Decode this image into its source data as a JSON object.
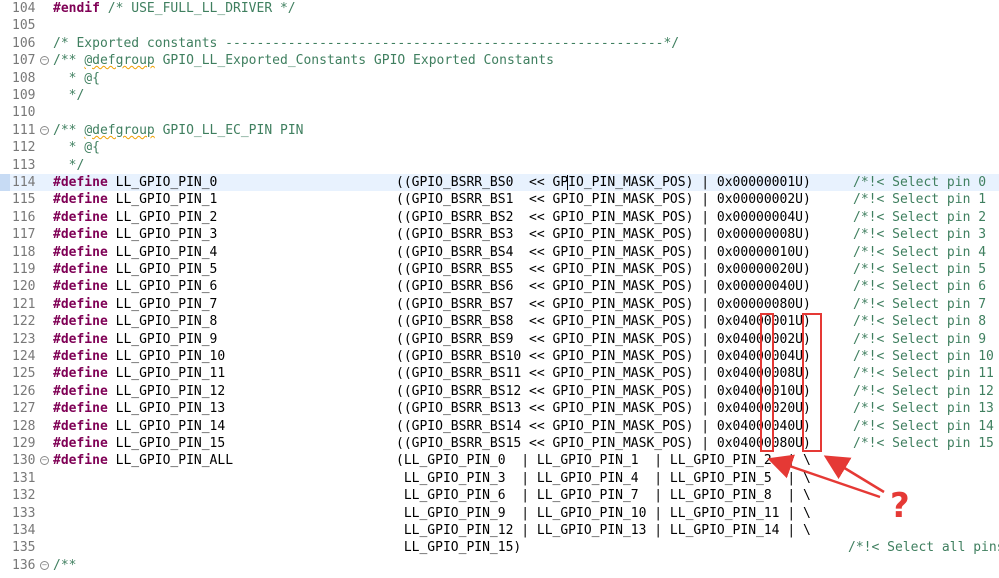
{
  "lines": [
    {
      "num": "104",
      "parts": [
        {
          "t": "#endif",
          "c": "kw"
        },
        {
          "t": " /* USE_FULL_LL_DRIVER */",
          "c": "cmt"
        }
      ]
    },
    {
      "num": "105",
      "parts": []
    },
    {
      "num": "106",
      "parts": [
        {
          "t": "/* Exported constants --------------------------------------------------------*/",
          "c": "cmt"
        }
      ]
    },
    {
      "num": "107",
      "fold": true,
      "parts": [
        {
          "t": "/** ",
          "c": "cmt"
        },
        {
          "t": "@defgroup",
          "c": "cmt squiggle"
        },
        {
          "t": " GPIO_LL_Exported_Constants GPIO Exported Constants",
          "c": "cmt"
        }
      ]
    },
    {
      "num": "108",
      "parts": [
        {
          "t": "  * @{",
          "c": "cmt"
        }
      ]
    },
    {
      "num": "109",
      "parts": [
        {
          "t": "  */",
          "c": "cmt"
        }
      ]
    },
    {
      "num": "110",
      "parts": []
    },
    {
      "num": "111",
      "fold": true,
      "parts": [
        {
          "t": "/** ",
          "c": "cmt"
        },
        {
          "t": "@defgroup",
          "c": "cmt squiggle"
        },
        {
          "t": " GPIO_LL_EC_PIN PIN",
          "c": "cmt"
        }
      ]
    },
    {
      "num": "112",
      "parts": [
        {
          "t": "  * @{",
          "c": "cmt"
        }
      ]
    },
    {
      "num": "113",
      "parts": [
        {
          "t": "  */",
          "c": "cmt"
        }
      ]
    },
    {
      "num": "114",
      "current": true,
      "def": "LL_GPIO_PIN_0",
      "expr": "((GPIO_BSRR_BS0  << GPIO_PIN_MASK_POS) | 0x00000001U)",
      "cmt": "/*!< Select pin 0"
    },
    {
      "num": "115",
      "def": "LL_GPIO_PIN_1",
      "expr": "((GPIO_BSRR_BS1  << GPIO_PIN_MASK_POS) | 0x00000002U)",
      "cmt": "/*!< Select pin 1"
    },
    {
      "num": "116",
      "def": "LL_GPIO_PIN_2",
      "expr": "((GPIO_BSRR_BS2  << GPIO_PIN_MASK_POS) | 0x00000004U)",
      "cmt": "/*!< Select pin 2"
    },
    {
      "num": "117",
      "def": "LL_GPIO_PIN_3",
      "expr": "((GPIO_BSRR_BS3  << GPIO_PIN_MASK_POS) | 0x00000008U)",
      "cmt": "/*!< Select pin 3"
    },
    {
      "num": "118",
      "def": "LL_GPIO_PIN_4",
      "expr": "((GPIO_BSRR_BS4  << GPIO_PIN_MASK_POS) | 0x00000010U)",
      "cmt": "/*!< Select pin 4"
    },
    {
      "num": "119",
      "def": "LL_GPIO_PIN_5",
      "expr": "((GPIO_BSRR_BS5  << GPIO_PIN_MASK_POS) | 0x00000020U)",
      "cmt": "/*!< Select pin 5"
    },
    {
      "num": "120",
      "def": "LL_GPIO_PIN_6",
      "expr": "((GPIO_BSRR_BS6  << GPIO_PIN_MASK_POS) | 0x00000040U)",
      "cmt": "/*!< Select pin 6"
    },
    {
      "num": "121",
      "def": "LL_GPIO_PIN_7",
      "expr": "((GPIO_BSRR_BS7  << GPIO_PIN_MASK_POS) | 0x00000080U)",
      "cmt": "/*!< Select pin 7"
    },
    {
      "num": "122",
      "def": "LL_GPIO_PIN_8",
      "expr": "((GPIO_BSRR_BS8  << GPIO_PIN_MASK_POS) | 0x04000001U)",
      "cmt": "/*!< Select pin 8"
    },
    {
      "num": "123",
      "def": "LL_GPIO_PIN_9",
      "expr": "((GPIO_BSRR_BS9  << GPIO_PIN_MASK_POS) | 0x04000002U)",
      "cmt": "/*!< Select pin 9"
    },
    {
      "num": "124",
      "def": "LL_GPIO_PIN_10",
      "expr": "((GPIO_BSRR_BS10 << GPIO_PIN_MASK_POS) | 0x04000004U)",
      "cmt": "/*!< Select pin 10"
    },
    {
      "num": "125",
      "def": "LL_GPIO_PIN_11",
      "expr": "((GPIO_BSRR_BS11 << GPIO_PIN_MASK_POS) | 0x04000008U)",
      "cmt": "/*!< Select pin 11"
    },
    {
      "num": "126",
      "def": "LL_GPIO_PIN_12",
      "expr": "((GPIO_BSRR_BS12 << GPIO_PIN_MASK_POS) | 0x04000010U)",
      "cmt": "/*!< Select pin 12"
    },
    {
      "num": "127",
      "def": "LL_GPIO_PIN_13",
      "expr": "((GPIO_BSRR_BS13 << GPIO_PIN_MASK_POS) | 0x04000020U)",
      "cmt": "/*!< Select pin 13"
    },
    {
      "num": "128",
      "def": "LL_GPIO_PIN_14",
      "expr": "((GPIO_BSRR_BS14 << GPIO_PIN_MASK_POS) | 0x04000040U)",
      "cmt": "/*!< Select pin 14"
    },
    {
      "num": "129",
      "def": "LL_GPIO_PIN_15",
      "expr": "((GPIO_BSRR_BS15 << GPIO_PIN_MASK_POS) | 0x04000080U)",
      "cmt": "/*!< Select pin 15"
    },
    {
      "num": "130",
      "fold": true,
      "def": "LL_GPIO_PIN_ALL",
      "expr": "(LL_GPIO_PIN_0  | LL_GPIO_PIN_1  | LL_GPIO_PIN_2  | \\"
    },
    {
      "num": "131",
      "expr": " LL_GPIO_PIN_3  | LL_GPIO_PIN_4  | LL_GPIO_PIN_5  | \\"
    },
    {
      "num": "132",
      "expr": " LL_GPIO_PIN_6  | LL_GPIO_PIN_7  | LL_GPIO_PIN_8  | \\"
    },
    {
      "num": "133",
      "expr": " LL_GPIO_PIN_9  | LL_GPIO_PIN_10 | LL_GPIO_PIN_11 | \\"
    },
    {
      "num": "134",
      "expr": " LL_GPIO_PIN_12 | LL_GPIO_PIN_13 | LL_GPIO_PIN_14 | \\"
    },
    {
      "num": "135",
      "expr": " LL_GPIO_PIN_15)",
      "cmt": "/*!< Select all pins"
    },
    {
      "num": "136",
      "fold": true,
      "parts": [
        {
          "t": "/**",
          "c": "cmt"
        }
      ]
    }
  ],
  "keywords": {
    "define": "#define"
  },
  "annotation": {
    "question_mark": "?",
    "color": "#e53935"
  },
  "colors": {
    "keyword": "#7f0055",
    "comment": "#3f7f5f",
    "line_number": "#787878",
    "current_line": "#e8f2fe"
  }
}
